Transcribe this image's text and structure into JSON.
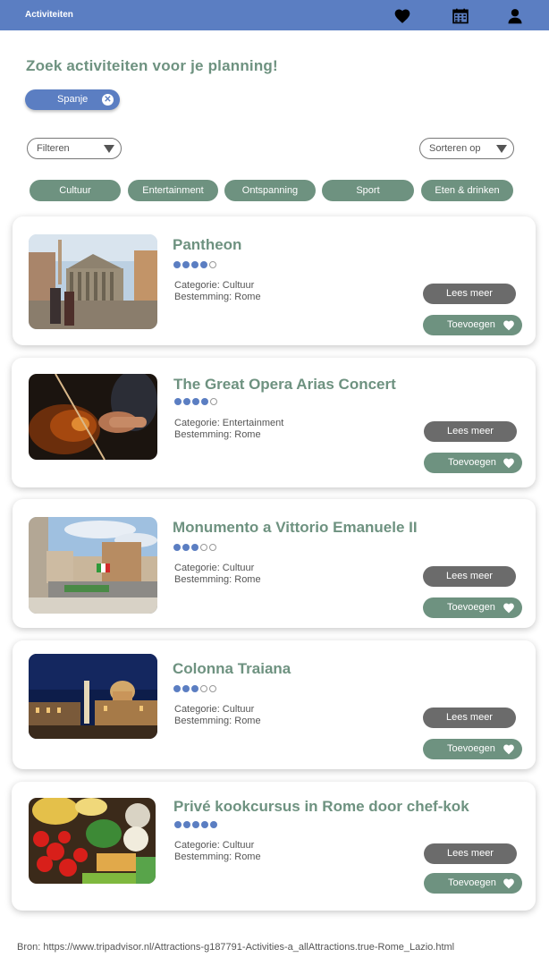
{
  "header": {
    "title": "Activiteiten",
    "color": "#5b7ec2",
    "icons": [
      "heart-icon",
      "calendar-icon",
      "user-icon"
    ]
  },
  "page": {
    "heading": "Zoek activiteiten voor je planning!",
    "heading_color": "#6e9280"
  },
  "filter_chip": {
    "label": "Spanje",
    "remove_icon": "close-circle-icon"
  },
  "controls": {
    "filter": {
      "label": "Filteren"
    },
    "sort": {
      "label": "Sorteren op"
    }
  },
  "categories": [
    "Cultuur",
    "Entertainment",
    "Ontspanning",
    "Sport",
    "Eten & drinken"
  ],
  "activities": [
    {
      "name": "Pantheon",
      "rating": 4,
      "rating_max": 5,
      "category": "Categorie: Cultuur",
      "destination": "Bestemming: Rome",
      "more_label": "Lees meer",
      "add_label": "Toevoegen",
      "image": "pantheon-photo"
    },
    {
      "name": "The Great Opera Arias Concert",
      "rating": 4,
      "rating_max": 5,
      "category": "Categorie: Entertainment",
      "destination": "Bestemming: Rome",
      "more_label": "Lees meer",
      "add_label": "Toevoegen",
      "image": "violin-photo"
    },
    {
      "name": "Monumento a Vittorio Emanuele II",
      "rating": 3,
      "rating_max": 5,
      "category": "Categorie: Cultuur",
      "destination": "Bestemming: Rome",
      "more_label": "Lees meer",
      "add_label": "Toevoegen",
      "image": "monument-photo"
    },
    {
      "name": "Colonna Traiana",
      "rating": 3,
      "rating_max": 5,
      "category": "Categorie: Cultuur",
      "destination": "Bestemming: Rome",
      "more_label": "Lees meer",
      "add_label": "Toevoegen",
      "image": "column-night-photo"
    },
    {
      "name": "Privé kookcursus in Rome door chef-kok",
      "rating": 5,
      "rating_max": 5,
      "category": "Categorie: Cultuur",
      "destination": "Bestemming: Rome",
      "more_label": "Lees meer",
      "add_label": "Toevoegen",
      "image": "vegetables-photo"
    }
  ],
  "source": "Bron: https://www.tripadvisor.nl/Attractions-g187791-Activities-a_allAttractions.true-Rome_Lazio.html"
}
